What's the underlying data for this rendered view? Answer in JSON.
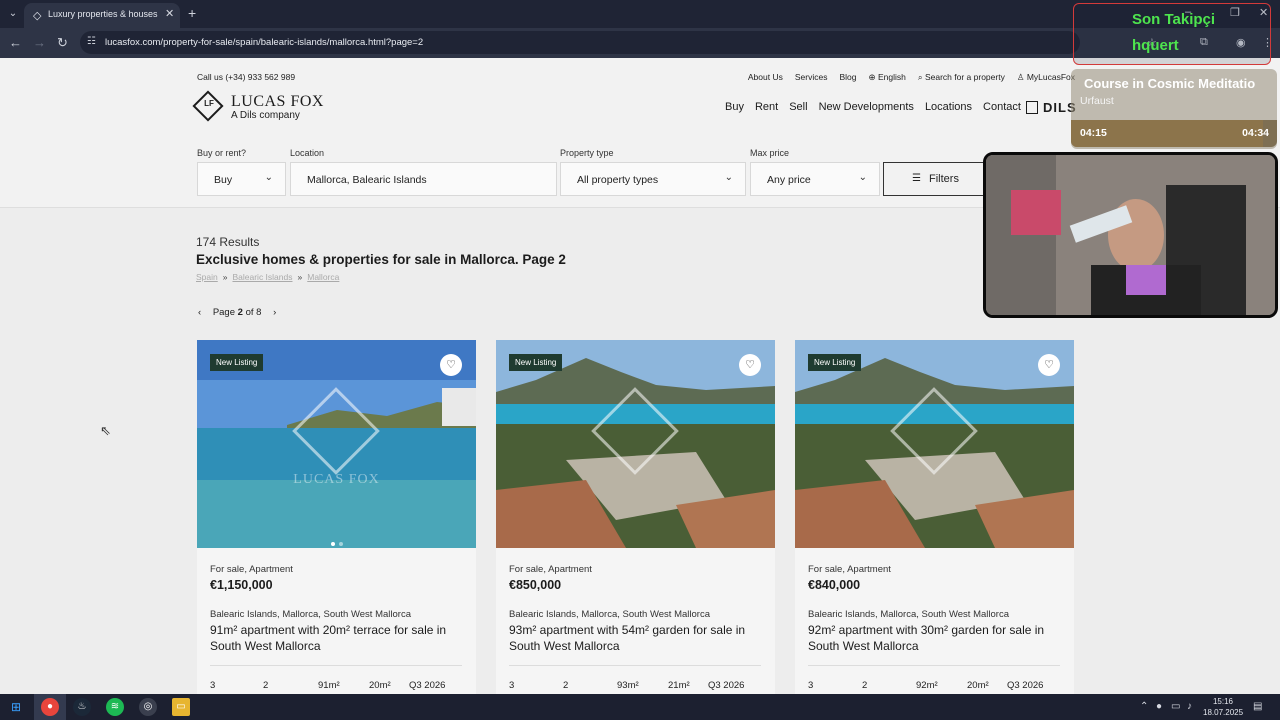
{
  "browser": {
    "tab_title": "Luxury properties & houses for sale in Mallorca",
    "url": "lucasfox.com/property-for-sale/spain/balearic-islands/mallorca.html?page=2"
  },
  "header": {
    "call_us": "Call us  (+34) 933 562 989",
    "top_links": [
      "About Us",
      "Services",
      "Blog",
      "English",
      "Search for a property",
      "MyLucasFox"
    ],
    "logo_name": "LUCAS FOX",
    "logo_sub": "A Dils company",
    "nav": [
      "Buy",
      "Rent",
      "Sell",
      "New Developments",
      "Locations",
      "Contact"
    ],
    "dils": "DILS"
  },
  "search": {
    "buy_rent_label": "Buy or rent?",
    "buy_rent_value": "Buy",
    "location_label": "Location",
    "location_value": "Mallorca, Balearic Islands",
    "type_label": "Property type",
    "type_value": "All property types",
    "price_label": "Max price",
    "price_value": "Any price",
    "filters": "Filters"
  },
  "results": {
    "count": "174 Results",
    "title": "Exclusive homes & properties for sale in Mallorca. Page 2",
    "breadcrumb": [
      "Spain",
      "Balearic Islands",
      "Mallorca"
    ],
    "page_prefix": "Page",
    "page_current": "2",
    "page_suffix": "of 8"
  },
  "listings": [
    {
      "badge": "New Listing",
      "type": "For sale, Apartment",
      "price": "€1,150,000",
      "location": "Balearic Islands, Mallorca, South West Mallorca",
      "title": "91m² apartment with 20m² terrace for sale in South West Mallorca",
      "features": [
        "3",
        "2",
        "91m²",
        "20m²",
        "Q3 2026"
      ]
    },
    {
      "badge": "New Listing",
      "type": "For sale, Apartment",
      "price": "€850,000",
      "location": "Balearic Islands, Mallorca, South West Mallorca",
      "title": "93m² apartment with 54m² garden for sale in South West Mallorca",
      "features": [
        "3",
        "2",
        "93m²",
        "21m²",
        "Q3 2026"
      ]
    },
    {
      "badge": "New Listing",
      "type": "For sale, Apartment",
      "price": "€840,000",
      "location": "Balearic Islands, Mallorca, South West Mallorca",
      "title": "92m² apartment with 30m² garden for sale in South West Mallorca",
      "features": [
        "3",
        "2",
        "92m²",
        "20m²",
        "Q3 2026"
      ]
    }
  ],
  "watermark": "LUCAS FOX",
  "overlay": {
    "follower_label": "Son Takipçi",
    "follower_name": "hquert",
    "track_title": "Course in Cosmic Meditatio",
    "track_artist": "Urfaust",
    "time_elapsed": "04:15",
    "time_total": "04:34",
    "progress": 0.93
  },
  "taskbar": {
    "time": "15:16",
    "date": "18.07.2025"
  },
  "colors": {
    "badge": "#1f3b30",
    "follower_text": "#4ee44e",
    "follower_border": "#d33a3a"
  }
}
